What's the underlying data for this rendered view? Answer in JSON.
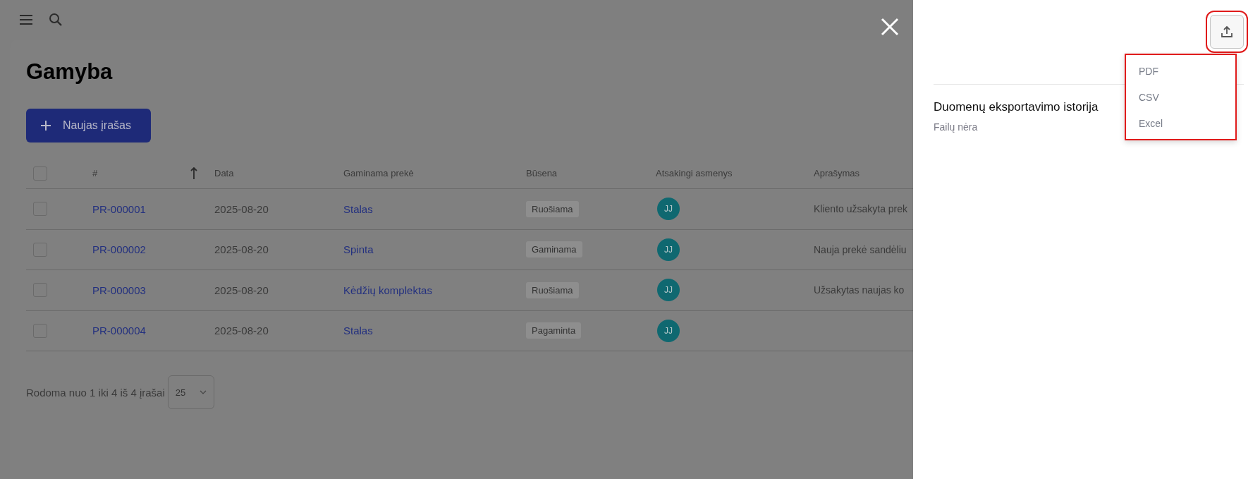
{
  "page": {
    "title": "Gamyba",
    "new_button": "Naujas įrašas"
  },
  "table": {
    "select_all": {
      "checked": false
    },
    "columns": [
      {
        "label": "#",
        "sort_ascending": true
      },
      {
        "label": "Data"
      },
      {
        "label": "Gaminama prekė"
      },
      {
        "label": "Būsena"
      },
      {
        "label": "Atsakingi asmenys"
      },
      {
        "label": "Aprašymas"
      }
    ],
    "rows": [
      {
        "checked": false,
        "id": "PR-000001",
        "date": "2025-08-20",
        "product": "Stalas",
        "status": "Ruošiama",
        "assignee": "JJ",
        "description": "Kliento užsakyta prek"
      },
      {
        "checked": false,
        "id": "PR-000002",
        "date": "2025-08-20",
        "product": "Spinta",
        "status": "Gaminama",
        "assignee": "JJ",
        "description": "Nauja prekė sandėliu"
      },
      {
        "checked": false,
        "id": "PR-000003",
        "date": "2025-08-20",
        "product": "Kėdžių komplektas",
        "status": "Ruošiama",
        "assignee": "JJ",
        "description": "Užsakytas naujas ko"
      },
      {
        "checked": false,
        "id": "PR-000004",
        "date": "2025-08-20",
        "product": "Stalas",
        "status": "Pagaminta",
        "assignee": "JJ"
      }
    ]
  },
  "pagination": {
    "summary": "Rodoma nuo 1 iki 4 iš 4 įrašai",
    "page_size": "25"
  },
  "panel": {
    "export_menu": {
      "expanded": true,
      "items": [
        "PDF",
        "CSV",
        "Excel"
      ]
    },
    "history_title": "Duomenų eksportavimo istorija",
    "empty_text": "Failų nėra"
  }
}
